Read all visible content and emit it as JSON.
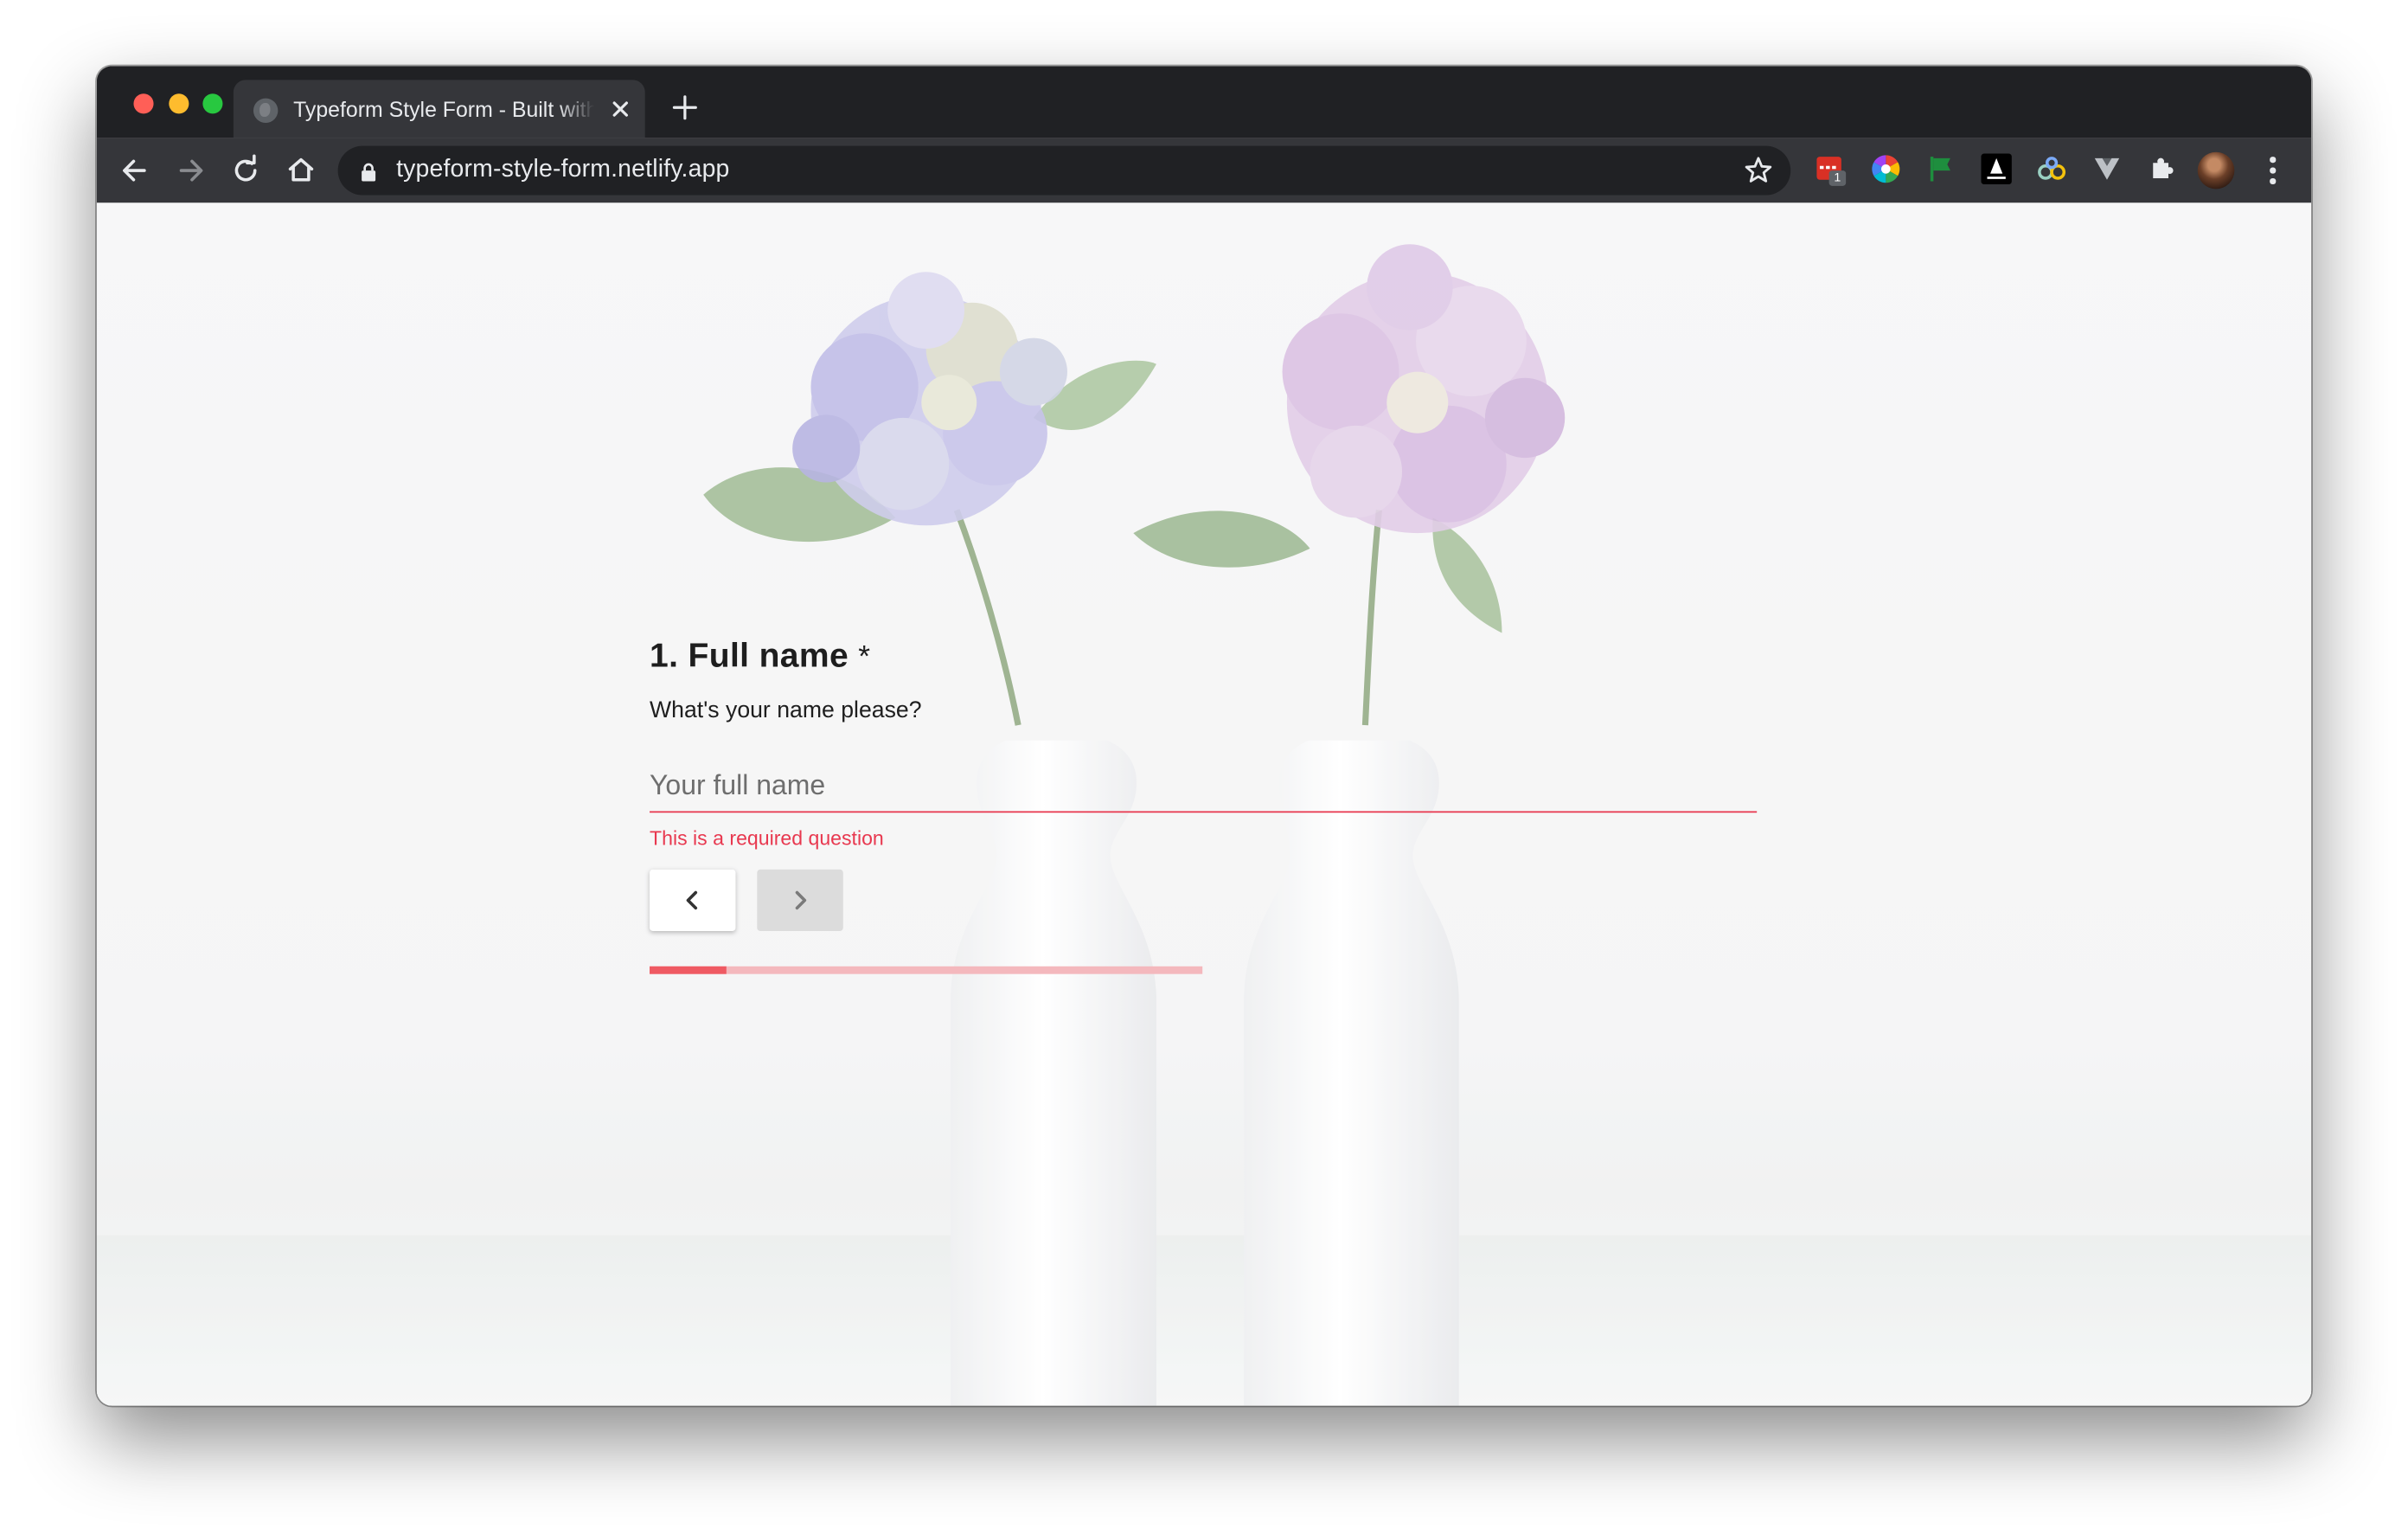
{
  "browser": {
    "tab": {
      "title": "Typeform Style Form - Built with Netlify",
      "favicon": "globe-icon"
    },
    "url": "typeform-style-form.netlify.app",
    "extensions": [
      {
        "name": "calendar-extension-icon",
        "badge": "1"
      },
      {
        "name": "color-wheel-extension-icon"
      },
      {
        "name": "flag-extension-icon"
      },
      {
        "name": "astro-extension-icon"
      },
      {
        "name": "binoculars-extension-icon"
      },
      {
        "name": "vue-devtools-icon"
      },
      {
        "name": "puzzle-extensions-icon"
      }
    ]
  },
  "form": {
    "question": {
      "number": "1.",
      "title": "Full name",
      "required_mark": "*",
      "description": "What's your name please?"
    },
    "answer": {
      "placeholder": "Your full name",
      "value": ""
    },
    "error": "This is a required question",
    "progress": 0.14
  },
  "colors": {
    "accent": "#e8384f",
    "progress_fill": "#ef5a63",
    "progress_track": "#f4b8bd",
    "chrome_dark": "#202124",
    "chrome_toolbar": "#35363a"
  }
}
